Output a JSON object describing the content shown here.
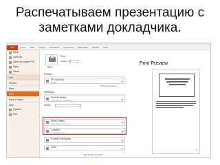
{
  "slide": {
    "title_line1": "Распечатываем презентацию с",
    "title_line2": "заметками докладчика.",
    "annotation": "Print Preview"
  },
  "ribbon": {
    "file_tab": "File",
    "tabs": [
      "Home",
      "Insert",
      "Design",
      "Transitions",
      "Animations",
      "Slide Show",
      "Review",
      "View"
    ]
  },
  "sidebar": {
    "top_items": [
      "Save",
      "Save As",
      "Save as Adobe PDF",
      "Open",
      "Close"
    ],
    "sections": [
      "Info",
      "Recent",
      "New",
      "Print",
      "Save & Send",
      "Help",
      "Options",
      "Exit"
    ],
    "active": "Print"
  },
  "print_panel": {
    "print_button": "Print",
    "copies_label": "Copies:",
    "copies_value": "1",
    "printer_header": "Printer",
    "printer_name": "HP LaserJet",
    "printer_status": "Ready",
    "printer_properties": "Printer Properties",
    "settings_header": "Settings",
    "setting_1_title": "Print All Slides",
    "setting_1_sub": "Print entire presentation",
    "slides_label": "Slides:",
    "setting_2_title": "Notes Pages",
    "setting_2_sub": "Print slides with notes",
    "setting_3_title": "Collated",
    "setting_3_sub": "1,2,3   1,2,3   1,2,3",
    "setting_4_title": "Portrait Orientation",
    "setting_5_title": "Color",
    "edit_link": "Edit Header & Footer"
  },
  "preview": {
    "page_number": "1"
  }
}
